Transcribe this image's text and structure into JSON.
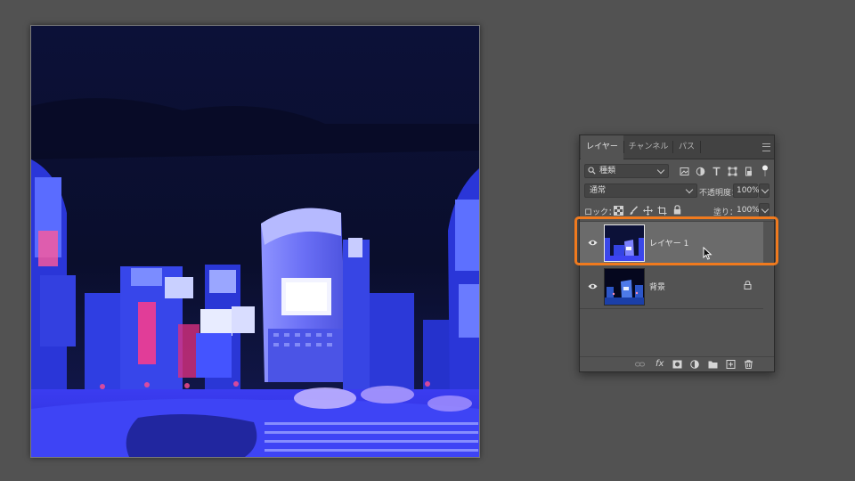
{
  "panel": {
    "tabs": [
      {
        "label": "レイヤー",
        "active": true
      },
      {
        "label": "チャンネル",
        "active": false
      },
      {
        "label": "パス",
        "active": false
      }
    ],
    "filter_kind": "種類",
    "blend_mode": "通常",
    "opacity_label": "不透明度：",
    "opacity_value": "100%",
    "lock_label": "ロック：",
    "fill_label": "塗り：",
    "fill_value": "100%",
    "fx_label": "fx"
  },
  "layers": [
    {
      "name": "レイヤー 1",
      "selected": true,
      "visible": true,
      "locked": false
    },
    {
      "name": "背景",
      "selected": false,
      "visible": true,
      "locked": true
    }
  ],
  "colors": {
    "highlight": "#f07a1e",
    "panel_bg": "#535353",
    "workspace_bg": "#525252"
  }
}
